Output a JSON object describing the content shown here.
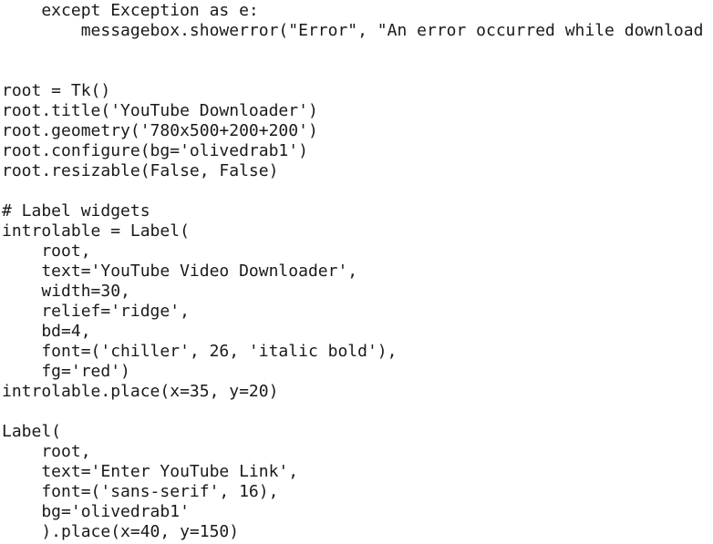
{
  "code": {
    "lines": [
      "    except Exception as e:",
      "        messagebox.showerror(\"Error\", \"An error occurred while download",
      "",
      "",
      "root = Tk()",
      "root.title('YouTube Downloader')",
      "root.geometry('780x500+200+200')",
      "root.configure(bg='olivedrab1')",
      "root.resizable(False, False)",
      "",
      "# Label widgets",
      "introlable = Label(",
      "    root,",
      "    text='YouTube Video Downloader',",
      "    width=30,",
      "    relief='ridge',",
      "    bd=4,",
      "    font=('chiller', 26, 'italic bold'),",
      "    fg='red')",
      "introlable.place(x=35, y=20)",
      "",
      "Label(",
      "    root,",
      "    text='Enter YouTube Link',",
      "    font=('sans-serif', 16),",
      "    bg='olivedrab1'",
      "    ).place(x=40, y=150)"
    ]
  }
}
